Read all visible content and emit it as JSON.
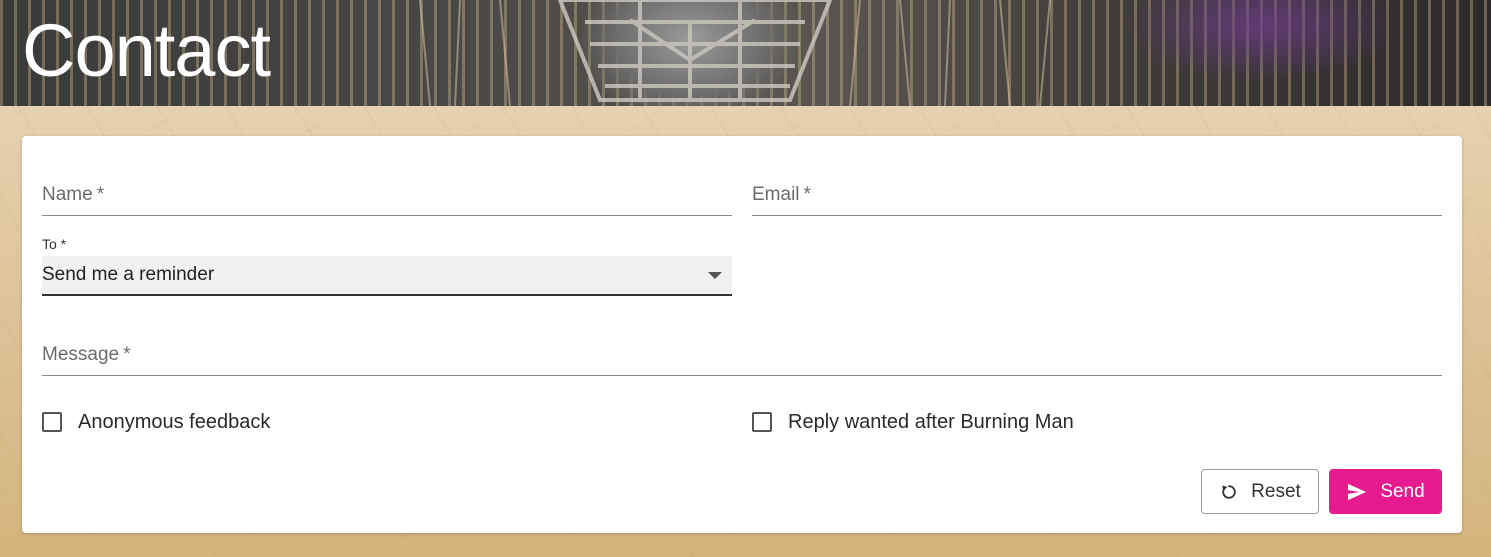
{
  "header": {
    "title": "Contact"
  },
  "form": {
    "name": {
      "label": "Name",
      "required_mark": "*"
    },
    "email": {
      "label": "Email",
      "required_mark": "*"
    },
    "to": {
      "label": "To *",
      "selected_value": "Send me a reminder"
    },
    "message": {
      "label": "Message",
      "required_mark": "*"
    },
    "checkboxes": [
      {
        "label": "Anonymous feedback",
        "checked": false
      },
      {
        "label": "Reply wanted after Burning Man",
        "checked": false
      }
    ],
    "buttons": {
      "reset_label": "Reset",
      "reset_icon": "reset-icon",
      "send_label": "Send",
      "send_icon": "send-icon"
    }
  },
  "colors": {
    "send_button": "#e6198f",
    "card_background": "#ffffff",
    "page_background": "#dcc295"
  }
}
